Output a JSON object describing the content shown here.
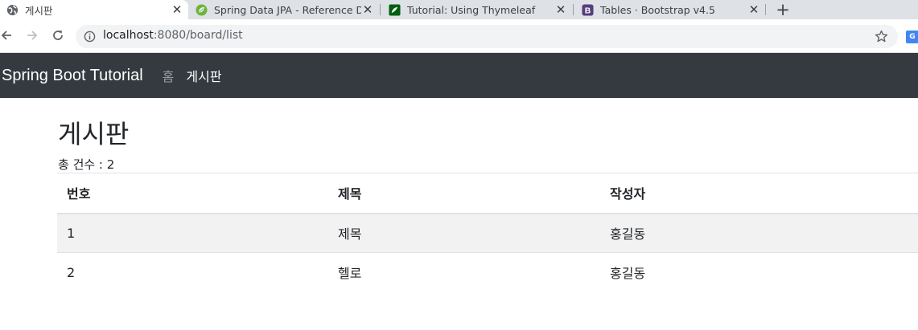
{
  "browser": {
    "tabs": [
      {
        "title": "게시판",
        "icon": "globe-icon",
        "active": true
      },
      {
        "title": "Spring Data JPA - Reference Do",
        "icon": "spring-leaf-icon",
        "active": false
      },
      {
        "title": "Tutorial: Using Thymeleaf",
        "icon": "thymeleaf-icon",
        "active": false
      },
      {
        "title": "Tables · Bootstrap v4.5",
        "icon": "bootstrap-icon",
        "active": false
      }
    ],
    "close_glyph": "✕",
    "new_tab_glyph": "+",
    "address": {
      "host": "localhost",
      "rest": ":8080/board/list"
    }
  },
  "navbar": {
    "brand": "Spring Boot Tutorial",
    "links": [
      {
        "label": "홈",
        "active": false
      },
      {
        "label": "게시판",
        "active": true
      }
    ],
    "background": "#343a40"
  },
  "page": {
    "title": "게시판",
    "total_label": "총 건수 : 2"
  },
  "table": {
    "headers": [
      "번호",
      "제목",
      "작성자"
    ],
    "rows": [
      [
        "1",
        "제목",
        "홍길동"
      ],
      [
        "2",
        "헬로",
        "홍길동"
      ]
    ]
  }
}
